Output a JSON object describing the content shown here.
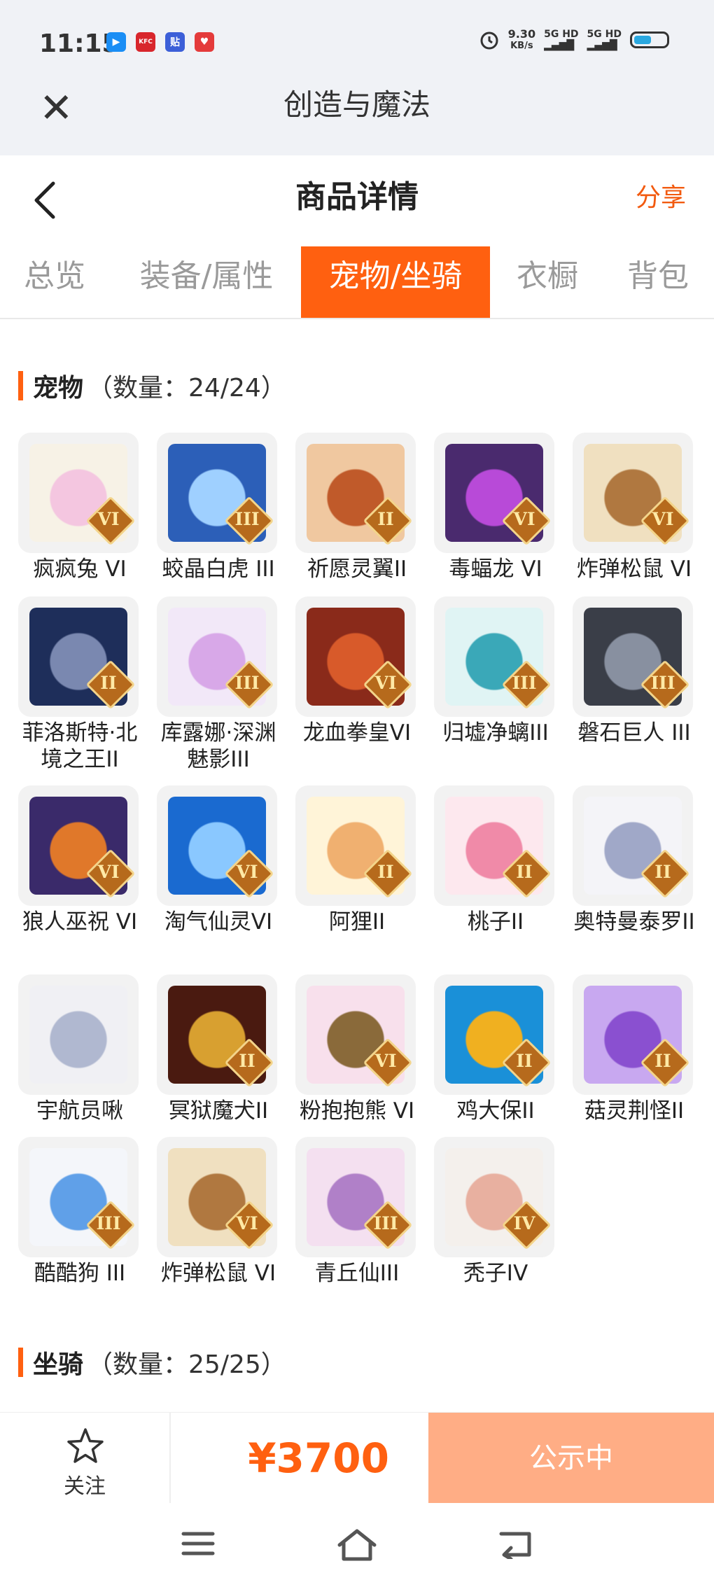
{
  "status_bar": {
    "time": "11:15",
    "apps": [
      {
        "name": "video-app-icon",
        "label": "▶",
        "color": "#1a8ef5"
      },
      {
        "name": "kfc-app-icon",
        "label": "KFC",
        "color": "#d8262c"
      },
      {
        "name": "tieba-app-icon",
        "label": "贴",
        "color": "#3c5fd8"
      },
      {
        "name": "heart-app-icon",
        "label": "♥",
        "color": "#e43b3b"
      }
    ],
    "net_speed": "9.30",
    "net_unit": "KB/s",
    "signal1": "5G HD",
    "signal2": "5G HD"
  },
  "app_bar": {
    "title": "创造与魔法"
  },
  "header": {
    "title": "商品详情",
    "share": "分享"
  },
  "tabs": [
    "总览",
    "装备/属性",
    "宠物/坐骑",
    "衣橱",
    "背包"
  ],
  "active_tab": 2,
  "pets_section": {
    "title": "宠物",
    "count": "（数量：24/24）"
  },
  "pets": [
    {
      "name": "疯疯兔 VI",
      "rank": "VI"
    },
    {
      "name": "蛟晶白虎 III",
      "rank": "III"
    },
    {
      "name": "祈愿灵翼II",
      "rank": "II"
    },
    {
      "name": "毒蝠龙 VI",
      "rank": "VI"
    },
    {
      "name": "炸弹松鼠 VI",
      "rank": "VI"
    },
    {
      "name": "菲洛斯特·北境之王II",
      "rank": "II"
    },
    {
      "name": "库露娜·深渊魅影III",
      "rank": "III"
    },
    {
      "name": "龙血拳皇VI",
      "rank": "VI"
    },
    {
      "name": "归墟净螭III",
      "rank": "III"
    },
    {
      "name": "磐石巨人 III",
      "rank": "III"
    },
    {
      "name": "狼人巫祝 VI",
      "rank": "VI"
    },
    {
      "name": "淘气仙灵VI",
      "rank": "VI"
    },
    {
      "name": "阿狸II",
      "rank": "II"
    },
    {
      "name": "桃子II",
      "rank": "II"
    },
    {
      "name": "奥特曼泰罗II",
      "rank": "II"
    },
    {
      "name": "宇航员啾",
      "rank": ""
    },
    {
      "name": "冥狱魔犬II",
      "rank": "II"
    },
    {
      "name": "粉抱抱熊 VI",
      "rank": "VI"
    },
    {
      "name": "鸡大保II",
      "rank": "II"
    },
    {
      "name": "菇灵荆怪II",
      "rank": "II"
    },
    {
      "name": "酷酷狗 III",
      "rank": "III"
    },
    {
      "name": "炸弹松鼠 VI",
      "rank": "VI"
    },
    {
      "name": "青丘仙III",
      "rank": "III"
    },
    {
      "name": "秃子IV",
      "rank": "IV"
    }
  ],
  "mounts_section": {
    "title": "坐骑",
    "count": "（数量：25/25）"
  },
  "bottom": {
    "follow": "关注",
    "price": "¥3700",
    "status": "公示中"
  },
  "colors": {
    "accent": "#ff6010",
    "status_button": "#ffad85"
  }
}
